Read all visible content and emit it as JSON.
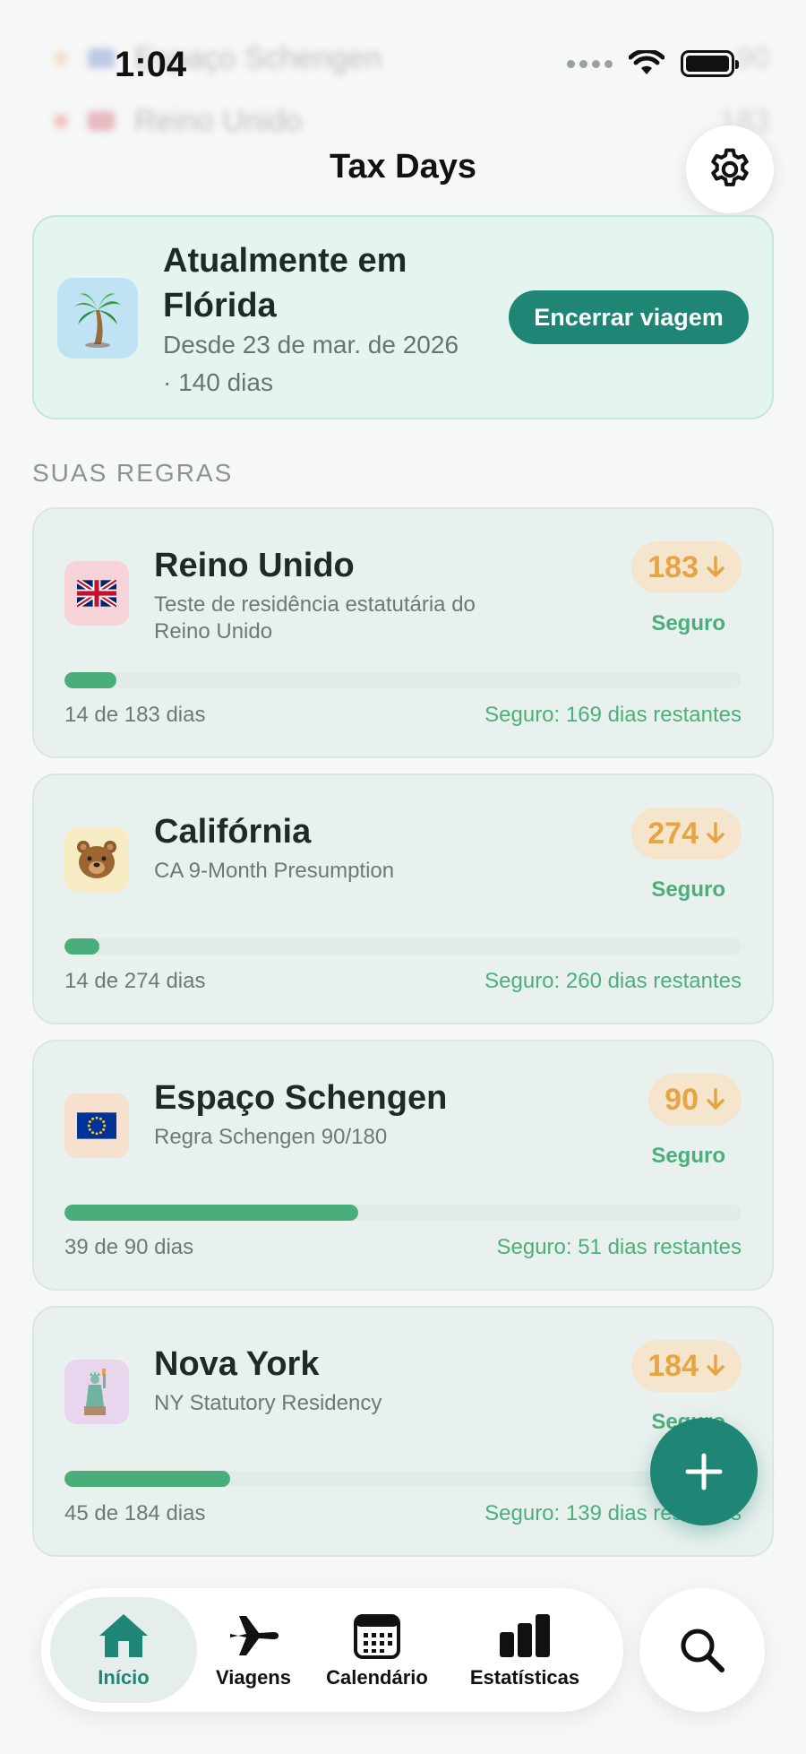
{
  "status_bar": {
    "time": "1:04"
  },
  "header": {
    "title": "Tax Days"
  },
  "background_peek": [
    {
      "label": "Espaço Schengen",
      "value": "90"
    },
    {
      "label": "Reino Unido",
      "value": "183"
    }
  ],
  "current_trip": {
    "title": "Atualmente em Flórida",
    "subtitle": "Desde 23 de mar. de 2026 · 140 dias",
    "icon": "palm-tree-icon",
    "end_button_label": "Encerrar viagem"
  },
  "section_label": "SUAS REGRAS",
  "rules": [
    {
      "name": "Reino Unido",
      "description": "Teste de residência estatutária do Reino Unido",
      "limit": "183",
      "status": "Seguro",
      "progress": 0.0765,
      "count_text": "14 de 183 dias",
      "remaining_text": "Seguro: 169 dias restantes",
      "icon": "uk-flag-icon",
      "icon_bg": "#f6d3d8"
    },
    {
      "name": "Califórnia",
      "description": "CA 9-Month Presumption",
      "limit": "274",
      "status": "Seguro",
      "progress": 0.0511,
      "count_text": "14 de 274 dias",
      "remaining_text": "Seguro: 260 dias restantes",
      "icon": "bear-face-icon",
      "icon_bg": "#f6ebc3"
    },
    {
      "name": "Espaço Schengen",
      "description": "Regra Schengen 90/180",
      "limit": "90",
      "status": "Seguro",
      "progress": 0.4333,
      "count_text": "39 de 90 dias",
      "remaining_text": "Seguro: 51 dias restantes",
      "icon": "eu-flag-icon",
      "icon_bg": "#f6e0ce"
    },
    {
      "name": "Nova York",
      "description": "NY Statutory Residency",
      "limit": "184",
      "status": "Seguro",
      "progress": 0.2446,
      "count_text": "45 de 184 dias",
      "remaining_text": "Seguro: 139 dias restantes",
      "icon": "statue-of-liberty-icon",
      "icon_bg": "#ead5ee"
    }
  ],
  "tabs": [
    {
      "label": "Início",
      "icon": "house-icon",
      "active": true
    },
    {
      "label": "Viagens",
      "icon": "airplane-icon",
      "active": false
    },
    {
      "label": "Calendário",
      "icon": "calendar-icon",
      "active": false
    },
    {
      "label": "Estatísticas",
      "icon": "bar-chart-icon",
      "active": false
    }
  ],
  "colors": {
    "accent": "#1f8574",
    "safe_green": "#4caf7b",
    "badge_orange": "#e7a443",
    "trip_card_bg": "#e4f4ef"
  }
}
